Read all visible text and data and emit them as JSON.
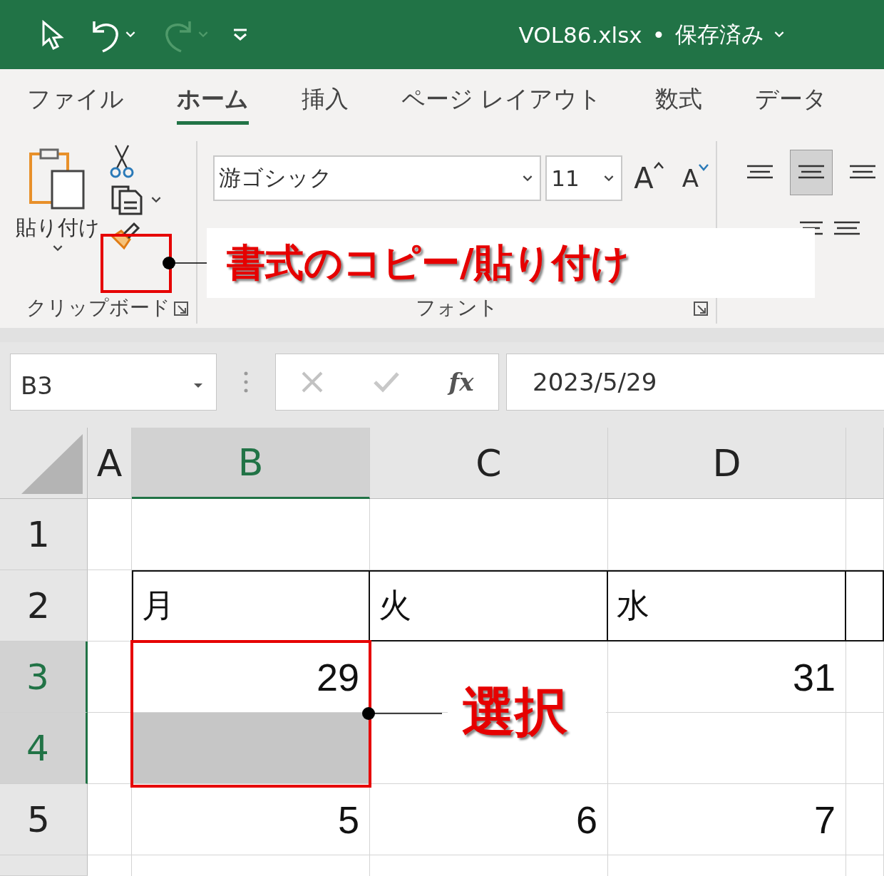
{
  "title_bar": {
    "file_name": "VOL86.xlsx",
    "separator": "•",
    "status": "保存済み",
    "redo_disabled": true
  },
  "tabs": [
    {
      "label": "ファイル",
      "selected": false
    },
    {
      "label": "ホーム",
      "selected": true
    },
    {
      "label": "挿入",
      "selected": false
    },
    {
      "label": "ページ レイアウト",
      "selected": false
    },
    {
      "label": "数式",
      "selected": false
    },
    {
      "label": "データ",
      "selected": false
    }
  ],
  "ribbon": {
    "paste_label": "貼り付け",
    "clipboard_label": "クリップボード",
    "font_name": "游ゴシック",
    "font_size": "11",
    "grow_font": "A",
    "shrink_font": "A",
    "font_label": "フォント",
    "align_buttons": [
      {
        "selected": false
      },
      {
        "selected": true
      },
      {
        "selected": false
      }
    ]
  },
  "formula_bar": {
    "name_box": "B3",
    "function_label": "fx",
    "formula": "2023/5/29"
  },
  "grid": {
    "columns": [
      {
        "label": "A",
        "selected": false
      },
      {
        "label": "B",
        "selected": true
      },
      {
        "label": "C",
        "selected": false
      },
      {
        "label": "D",
        "selected": false
      }
    ],
    "rows": [
      {
        "label": "1",
        "selected": false,
        "kind": "number",
        "b_filled": false,
        "cells": {}
      },
      {
        "label": "2",
        "selected": false,
        "kind": "table-header",
        "b_filled": false,
        "cells": {
          "B": "月",
          "C": "火",
          "D": "水"
        }
      },
      {
        "label": "3",
        "selected": true,
        "kind": "number",
        "b_filled": false,
        "cells": {
          "B": "29",
          "D": "31"
        }
      },
      {
        "label": "4",
        "selected": true,
        "kind": "number",
        "b_filled": true,
        "cells": {}
      },
      {
        "label": "5",
        "selected": false,
        "kind": "number",
        "b_filled": false,
        "cells": {
          "B": "5",
          "C": "6",
          "D": "7"
        }
      }
    ]
  },
  "annotations": [
    {
      "text": "書式のコピー/貼り付け"
    },
    {
      "text": "選択"
    }
  ]
}
